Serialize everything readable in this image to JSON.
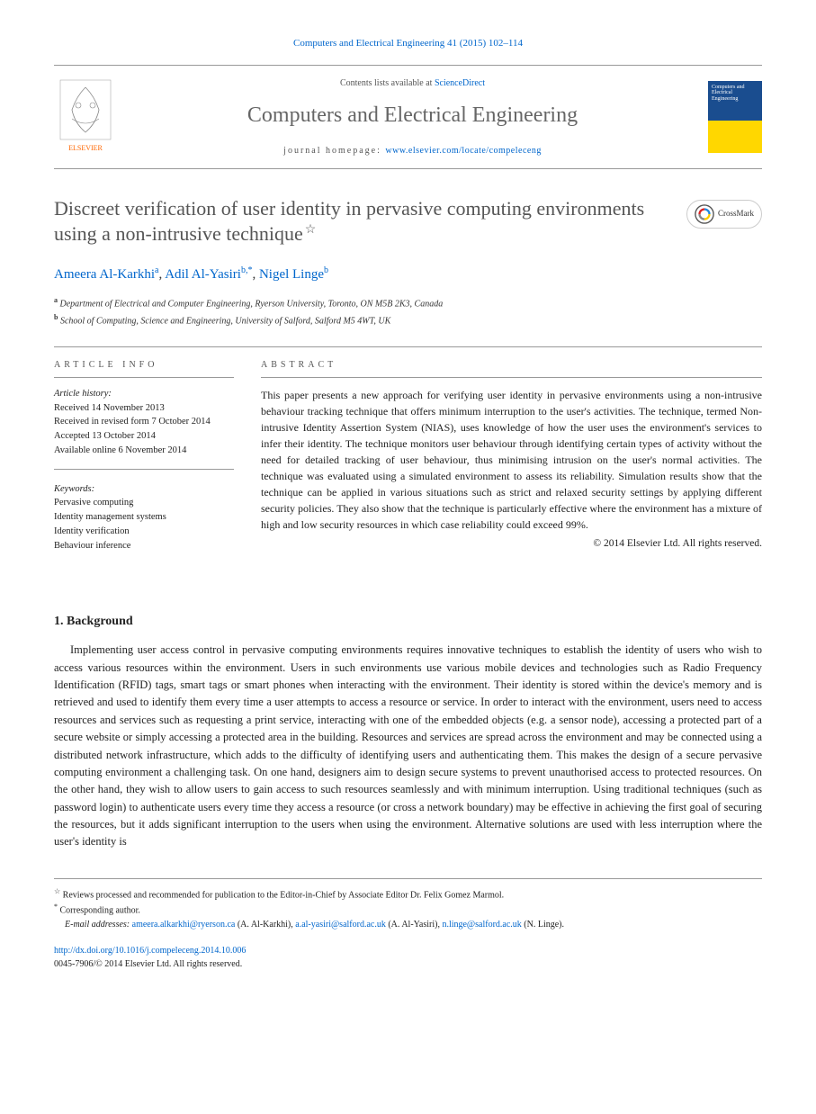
{
  "header": {
    "citation": "Computers and Electrical Engineering 41 (2015) 102–114"
  },
  "journal": {
    "contents_prefix": "Contents lists available at ",
    "contents_link": "ScienceDirect",
    "title": "Computers and Electrical Engineering",
    "homepage_prefix": "journal homepage: ",
    "homepage_url": "www.elsevier.com/locate/compeleceng",
    "publisher": "ELSEVIER",
    "cover_title": "Computers and Electrical Engineering"
  },
  "paper": {
    "title": "Discreet verification of user identity in pervasive computing environments using a non-intrusive technique",
    "crossmark": "CrossMark",
    "authors": [
      {
        "name": "Ameera Al-Karkhi",
        "sup": "a"
      },
      {
        "name": "Adil Al-Yasiri",
        "sup": "b,*"
      },
      {
        "name": "Nigel Linge",
        "sup": "b"
      }
    ],
    "affiliations": [
      {
        "sup": "a",
        "text": "Department of Electrical and Computer Engineering, Ryerson University, Toronto, ON M5B 2K3, Canada"
      },
      {
        "sup": "b",
        "text": "School of Computing, Science and Engineering, University of Salford, Salford M5 4WT, UK"
      }
    ]
  },
  "article_info": {
    "header": "ARTICLE INFO",
    "history_label": "Article history:",
    "history": [
      "Received 14 November 2013",
      "Received in revised form 7 October 2014",
      "Accepted 13 October 2014",
      "Available online 6 November 2014"
    ],
    "keywords_label": "Keywords:",
    "keywords": [
      "Pervasive computing",
      "Identity management systems",
      "Identity verification",
      "Behaviour inference"
    ]
  },
  "abstract": {
    "header": "ABSTRACT",
    "text": "This paper presents a new approach for verifying user identity in pervasive environments using a non-intrusive behaviour tracking technique that offers minimum interruption to the user's activities. The technique, termed Non-intrusive Identity Assertion System (NIAS), uses knowledge of how the user uses the environment's services to infer their identity. The technique monitors user behaviour through identifying certain types of activity without the need for detailed tracking of user behaviour, thus minimising intrusion on the user's normal activities. The technique was evaluated using a simulated environment to assess its reliability. Simulation results show that the technique can be applied in various situations such as strict and relaxed security settings by applying different security policies. They also show that the technique is particularly effective where the environment has a mixture of high and low security resources in which case reliability could exceed 99%.",
    "copyright": "© 2014 Elsevier Ltd. All rights reserved."
  },
  "body": {
    "section1_title": "1. Background",
    "section1_text": "Implementing user access control in pervasive computing environments requires innovative techniques to establish the identity of users who wish to access various resources within the environment. Users in such environments use various mobile devices and technologies such as Radio Frequency Identification (RFID) tags, smart tags or smart phones when interacting with the environment. Their identity is stored within the device's memory and is retrieved and used to identify them every time a user attempts to access a resource or service. In order to interact with the environment, users need to access resources and services such as requesting a print service, interacting with one of the embedded objects (e.g. a sensor node), accessing a protected part of a secure website or simply accessing a protected area in the building. Resources and services are spread across the environment and may be connected using a distributed network infrastructure, which adds to the difficulty of identifying users and authenticating them. This makes the design of a secure pervasive computing environment a challenging task. On one hand, designers aim to design secure systems to prevent unauthorised access to protected resources. On the other hand, they wish to allow users to gain access to such resources seamlessly and with minimum interruption. Using traditional techniques (such as password login) to authenticate users every time they access a resource (or cross a network boundary) may be effective in achieving the first goal of securing the resources, but it adds significant interruption to the users when using the environment. Alternative solutions are used with less interruption where the user's identity is"
  },
  "footnotes": {
    "star": "Reviews processed and recommended for publication to the Editor-in-Chief by Associate Editor Dr. Felix Gomez Marmol.",
    "corresponding": "Corresponding author.",
    "emails_label": "E-mail addresses: ",
    "emails": [
      {
        "addr": "ameera.alkarkhi@ryerson.ca",
        "name": "(A. Al-Karkhi)"
      },
      {
        "addr": "a.al-yasiri@salford.ac.uk",
        "name": "(A. Al-Yasiri)"
      },
      {
        "addr": "n.linge@salford.ac.uk",
        "name": "(N. Linge)"
      }
    ]
  },
  "footer": {
    "doi": "http://dx.doi.org/10.1016/j.compeleceng.2014.10.006",
    "issn_copyright": "0045-7906/© 2014 Elsevier Ltd. All rights reserved."
  }
}
